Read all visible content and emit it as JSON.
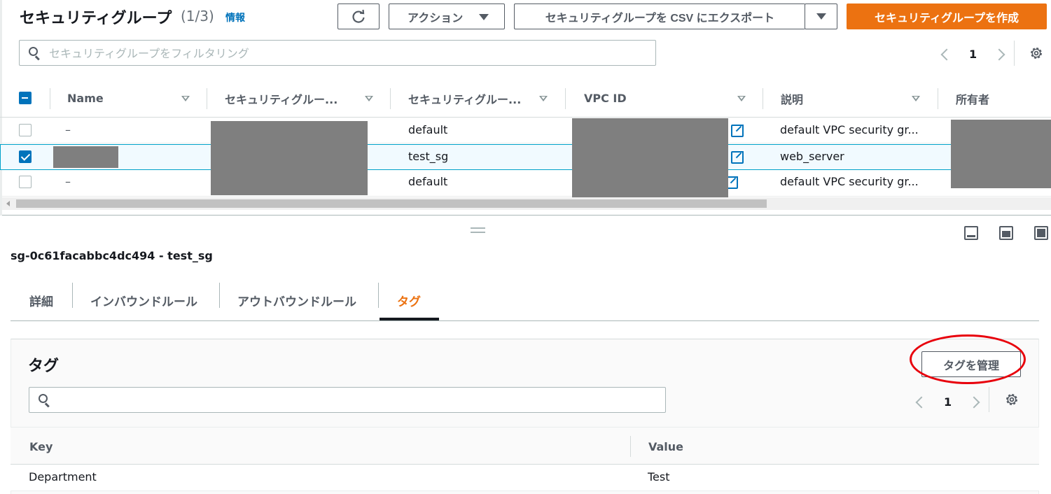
{
  "header": {
    "title": "セキュリティグループ",
    "count": "(1/3)",
    "info_link": "情報",
    "refresh_icon": "refresh-icon",
    "actions_label": "アクション",
    "export_label": "セキュリティグループを CSV にエクスポート",
    "create_label": "セキュリティグループを作成"
  },
  "filter": {
    "placeholder": "セキュリティグループをフィルタリング",
    "value": ""
  },
  "pagination": {
    "page": "1"
  },
  "table": {
    "columns": [
      "Name",
      "セキュリティグルー...",
      "セキュリティグルー...",
      "VPC ID",
      "説明",
      "所有者"
    ],
    "rows": [
      {
        "checked": false,
        "name": "–",
        "group_name": "default",
        "description": "default VPC security gr..."
      },
      {
        "checked": true,
        "name": "",
        "group_name": "test_sg",
        "description": "web_server"
      },
      {
        "checked": false,
        "name": "–",
        "group_name": "default",
        "description": "default VPC security gr..."
      }
    ]
  },
  "detail": {
    "title": "sg-0c61facabbc4dc494 - test_sg",
    "tabs": [
      "詳細",
      "インバウンドルール",
      "アウトバウンドルール",
      "タグ"
    ],
    "active_tab": "タグ"
  },
  "tags": {
    "title": "タグ",
    "manage_label": "タグを管理",
    "search_value": "",
    "page": "1",
    "columns": [
      "Key",
      "Value"
    ],
    "rows": [
      {
        "key": "Department",
        "value": "Test"
      }
    ]
  },
  "colors": {
    "primary": "#ec7211",
    "link": "#0073bb",
    "annotation": "#e8000b",
    "redaction": "#7f7f7f"
  }
}
